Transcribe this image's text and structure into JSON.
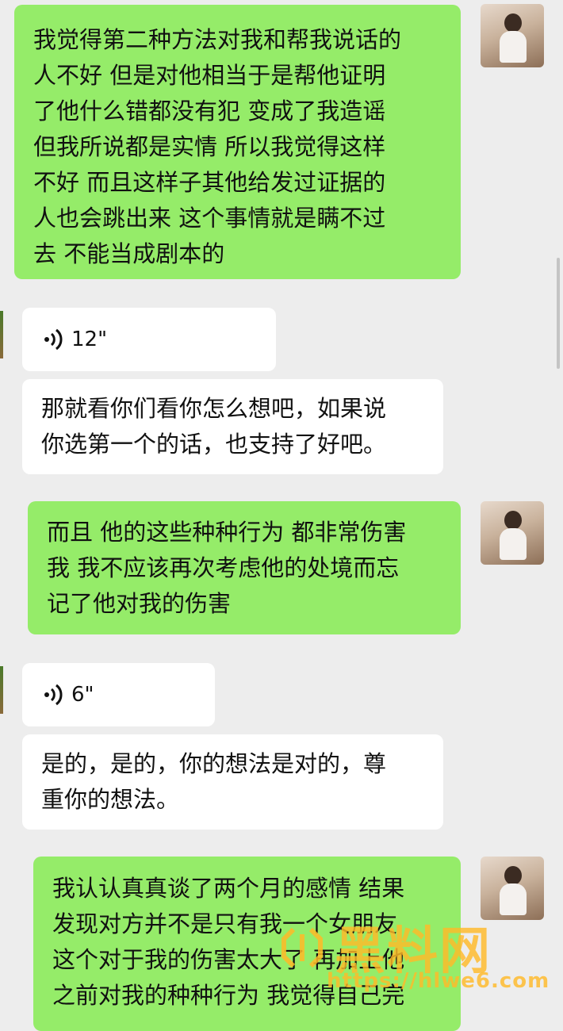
{
  "messages": [
    {
      "side": "sent",
      "type": "text",
      "text": "我觉得第二种方法对我和帮我说话的\n人不好 但是对他相当于是帮他证明\n了他什么错都没有犯 变成了我造谣\n但我所说都是实情 所以我觉得这样\n不好 而且这样子其他给发过证据的\n人也会跳出来 这个事情就是瞒不过\n去 不能当成剧本的"
    },
    {
      "side": "received",
      "type": "voice",
      "duration": "12\""
    },
    {
      "side": "received",
      "type": "text",
      "text": "那就看你们看你怎么想吧，如果说\n你选第一个的话，也支持了好吧。"
    },
    {
      "side": "sent",
      "type": "text",
      "text": "而且 他的这些种种行为 都非常伤害\n我 我不应该再次考虑他的处境而忘\n记了他对我的伤害"
    },
    {
      "side": "received",
      "type": "voice",
      "duration": "6\""
    },
    {
      "side": "received",
      "type": "text",
      "text": "是的，是的，你的想法是对的，尊\n重你的想法。"
    },
    {
      "side": "sent",
      "type": "text",
      "text": "我认认真真谈了两个月的感情 结果\n发现对方并不是只有我一个女朋友\n这个对于我的伤害太大了 再加上他\n之前对我的种种行为 我觉得自己完"
    }
  ],
  "icons": {
    "voice": "voice-wave-icon",
    "avatar": "user-avatar-photo"
  },
  "colors": {
    "sent_bubble": "#95ec69",
    "received_bubble": "#ffffff",
    "background": "#ededed"
  },
  "watermark": {
    "title": "黑料网",
    "url": "https://hlwe6.com"
  }
}
